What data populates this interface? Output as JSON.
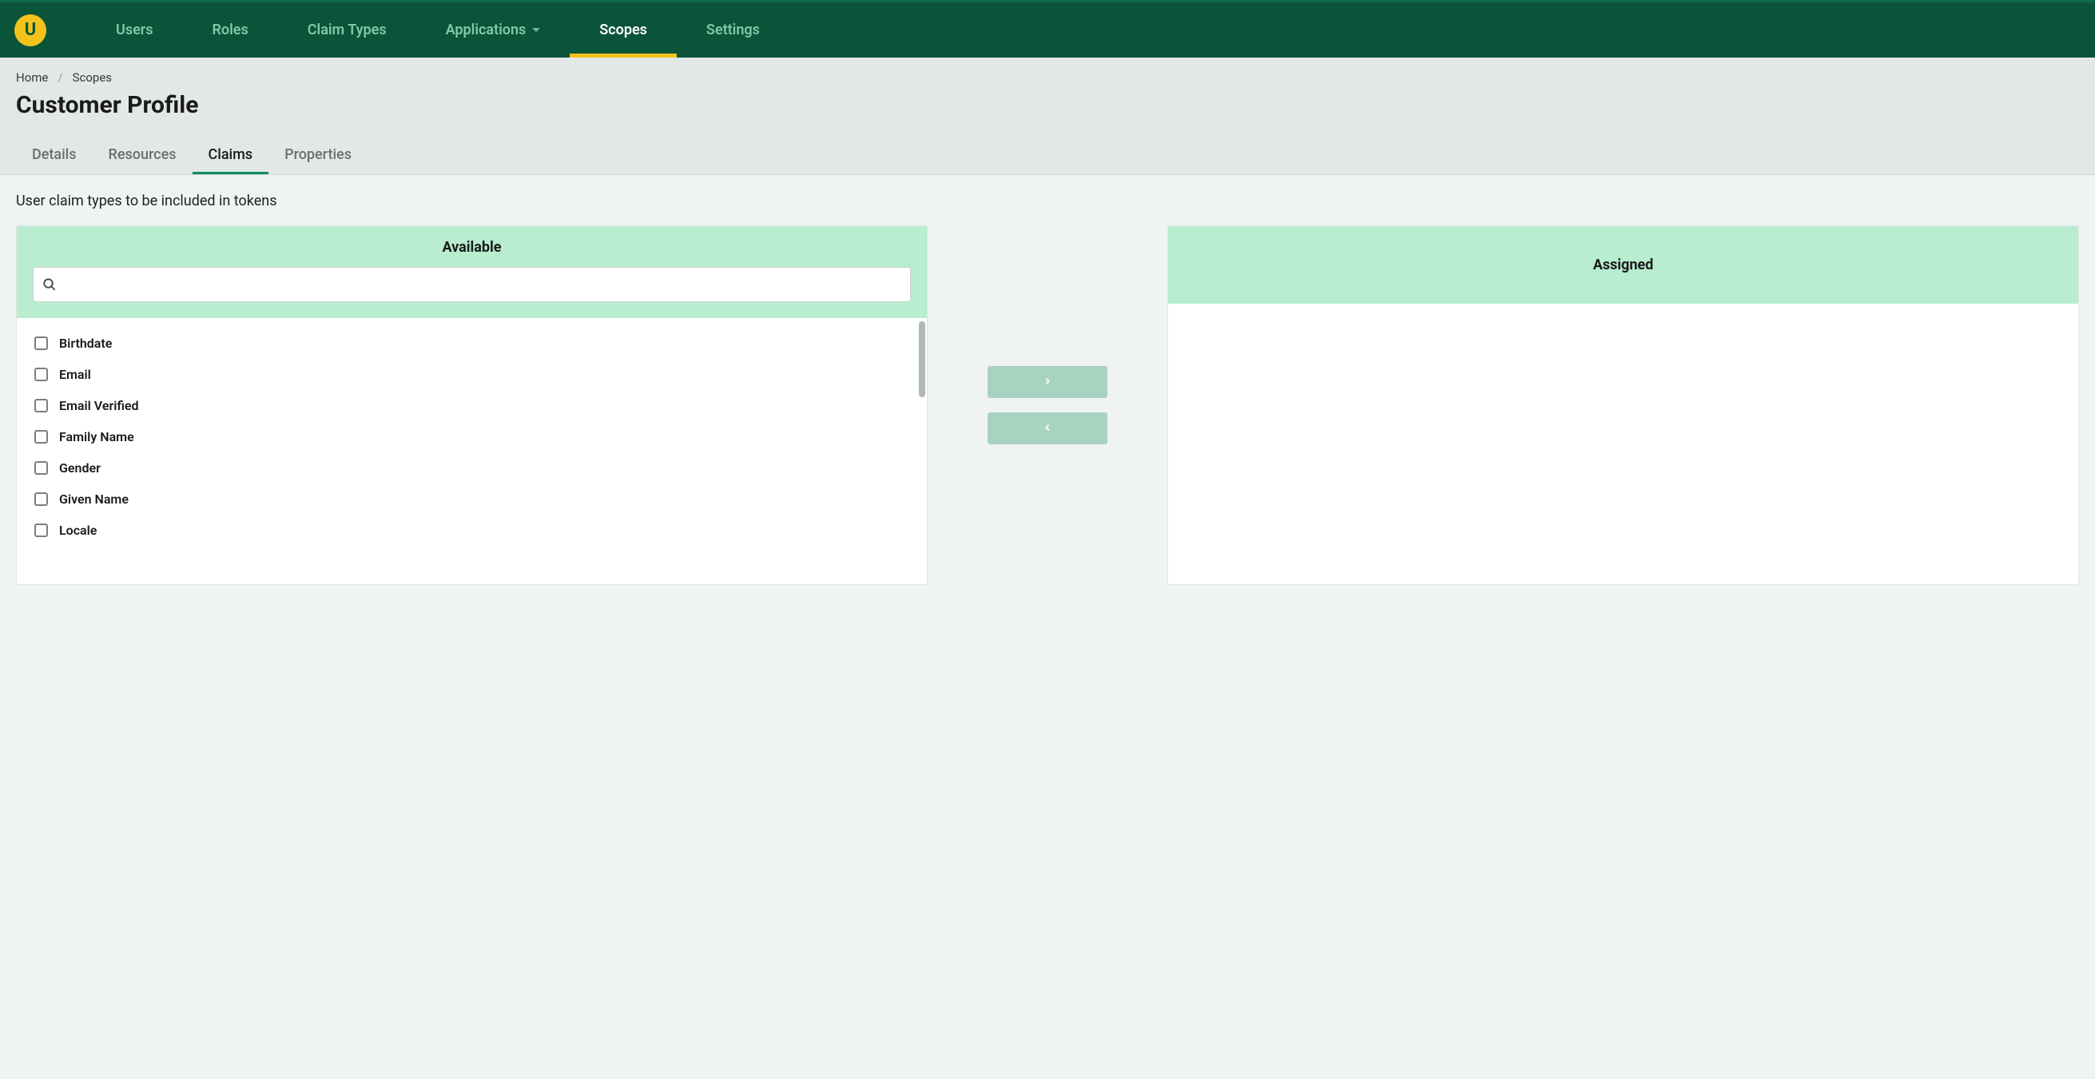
{
  "nav": {
    "items": [
      {
        "label": "Users",
        "active": false,
        "hasDropdown": false
      },
      {
        "label": "Roles",
        "active": false,
        "hasDropdown": false
      },
      {
        "label": "Claim Types",
        "active": false,
        "hasDropdown": false
      },
      {
        "label": "Applications",
        "active": false,
        "hasDropdown": true
      },
      {
        "label": "Scopes",
        "active": true,
        "hasDropdown": false
      },
      {
        "label": "Settings",
        "active": false,
        "hasDropdown": false
      }
    ]
  },
  "breadcrumb": {
    "items": [
      {
        "label": "Home"
      },
      {
        "label": "Scopes"
      }
    ]
  },
  "page_title": "Customer Profile",
  "tabs": [
    {
      "label": "Details",
      "active": false
    },
    {
      "label": "Resources",
      "active": false
    },
    {
      "label": "Claims",
      "active": true
    },
    {
      "label": "Properties",
      "active": false
    }
  ],
  "subtitle": "User claim types to be included in tokens",
  "available": {
    "title": "Available",
    "search_placeholder": "",
    "items": [
      {
        "label": "Birthdate"
      },
      {
        "label": "Email"
      },
      {
        "label": "Email Verified"
      },
      {
        "label": "Family Name"
      },
      {
        "label": "Gender"
      },
      {
        "label": "Given Name"
      },
      {
        "label": "Locale"
      }
    ]
  },
  "assigned": {
    "title": "Assigned",
    "items": []
  }
}
